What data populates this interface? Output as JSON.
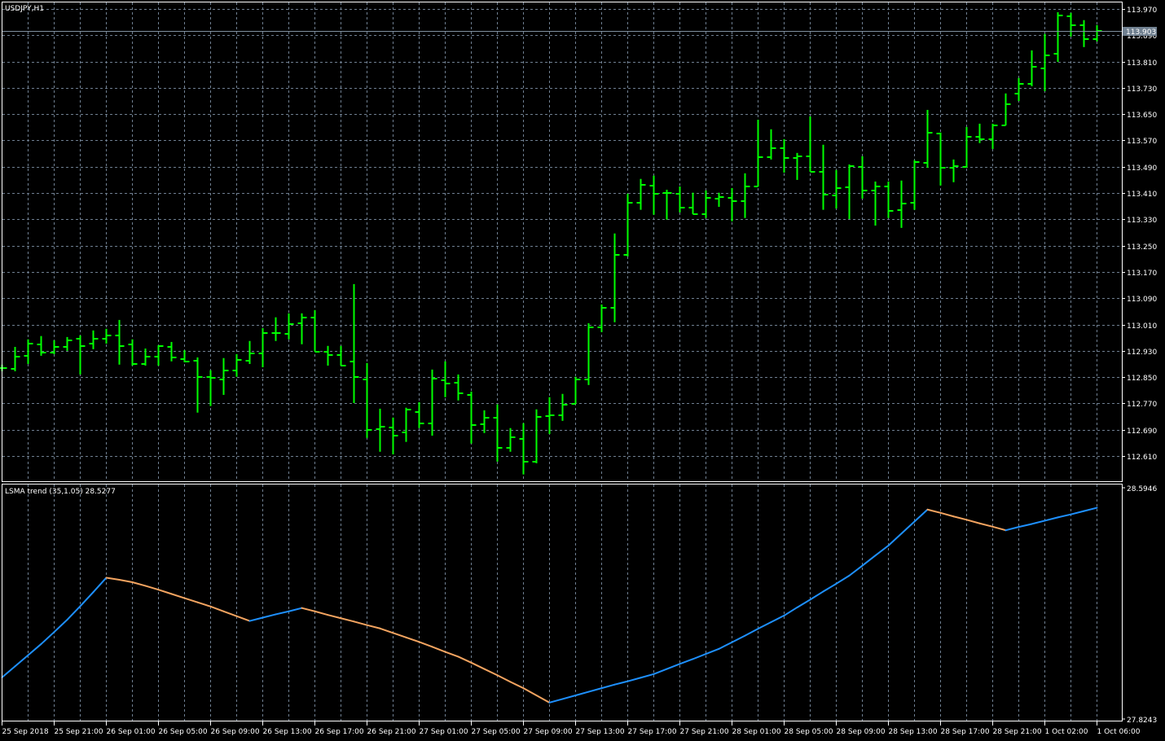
{
  "chart_data": [
    {
      "type": "ohlc-bar",
      "title": "USDJPY,H1",
      "symbol": "USDJPY",
      "timeframe": "H1",
      "ylim": [
        112.57,
        113.99
      ],
      "y_ticks": [
        "113.970",
        "113.890",
        "113.810",
        "113.730",
        "113.650",
        "113.570",
        "113.490",
        "113.410",
        "113.330",
        "113.250",
        "113.170",
        "113.090",
        "113.010",
        "112.930",
        "112.850",
        "112.770",
        "112.690",
        "112.610"
      ],
      "current_price": "113.903",
      "grid": true,
      "bar_color": "#00FF00",
      "bars_ohlc": [
        [
          112.878,
          112.888,
          112.868,
          112.878
        ],
        [
          112.876,
          112.942,
          112.868,
          112.913
        ],
        [
          112.915,
          112.965,
          112.89,
          112.952
        ],
        [
          112.95,
          112.975,
          112.915,
          112.925
        ],
        [
          112.925,
          112.962,
          112.92,
          112.942
        ],
        [
          112.942,
          112.972,
          112.93,
          112.962
        ],
        [
          112.967,
          112.977,
          112.858,
          112.945
        ],
        [
          112.952,
          112.992,
          112.935,
          112.967
        ],
        [
          112.967,
          112.997,
          112.952,
          112.977
        ],
        [
          112.977,
          113.024,
          112.888,
          112.945
        ],
        [
          112.95,
          112.965,
          112.885,
          112.89
        ],
        [
          112.89,
          112.937,
          112.885,
          112.913
        ],
        [
          112.913,
          112.947,
          112.885,
          112.945
        ],
        [
          112.942,
          112.957,
          112.898,
          112.91
        ],
        [
          112.905,
          112.932,
          112.895,
          112.898
        ],
        [
          112.9,
          112.91,
          112.742,
          112.851
        ],
        [
          112.851,
          112.871,
          112.762,
          112.848
        ],
        [
          112.843,
          112.908,
          112.796,
          112.871
        ],
        [
          112.871,
          112.92,
          112.851,
          112.903
        ],
        [
          112.9,
          112.96,
          112.89,
          112.923
        ],
        [
          112.923,
          112.999,
          112.88,
          112.984
        ],
        [
          112.984,
          113.032,
          112.96,
          112.984
        ],
        [
          112.982,
          113.044,
          112.965,
          113.012
        ],
        [
          113.014,
          113.044,
          112.95,
          113.032
        ],
        [
          113.032,
          113.054,
          112.928,
          112.928
        ],
        [
          112.928,
          112.945,
          112.885,
          112.918
        ],
        [
          112.918,
          112.945,
          112.885,
          112.885
        ],
        [
          112.898,
          113.133,
          112.771,
          112.851
        ],
        [
          112.843,
          112.893,
          112.665,
          112.69
        ],
        [
          112.692,
          112.754,
          112.623,
          112.7
        ],
        [
          112.697,
          112.727,
          112.615,
          112.672
        ],
        [
          112.682,
          112.757,
          112.653,
          112.752
        ],
        [
          112.744,
          112.774,
          112.695,
          112.71
        ],
        [
          112.71,
          112.873,
          112.672,
          112.846
        ],
        [
          112.841,
          112.898,
          112.789,
          112.831
        ],
        [
          112.833,
          112.858,
          112.779,
          112.801
        ],
        [
          112.796,
          112.806,
          112.648,
          112.705
        ],
        [
          112.707,
          112.749,
          112.68,
          112.727
        ],
        [
          112.727,
          112.767,
          112.593,
          112.635
        ],
        [
          112.635,
          112.695,
          112.623,
          112.667
        ],
        [
          112.662,
          112.71,
          112.554,
          112.593
        ],
        [
          112.593,
          112.752,
          112.588,
          112.729
        ],
        [
          112.732,
          112.789,
          112.677,
          112.734
        ],
        [
          112.734,
          112.799,
          112.717,
          112.767
        ],
        [
          112.769,
          112.851,
          112.769,
          112.843
        ],
        [
          112.843,
          113.014,
          112.826,
          113.002
        ],
        [
          113.002,
          113.071,
          112.987,
          113.061
        ],
        [
          113.061,
          113.287,
          113.017,
          113.222
        ],
        [
          113.222,
          113.408,
          113.217,
          113.381
        ],
        [
          113.381,
          113.453,
          113.359,
          113.435
        ],
        [
          113.433,
          113.463,
          113.344,
          113.408
        ],
        [
          113.411,
          113.42,
          113.329,
          113.411
        ],
        [
          113.408,
          113.43,
          113.351,
          113.366
        ],
        [
          113.366,
          113.411,
          113.346,
          113.346
        ],
        [
          113.346,
          113.418,
          113.334,
          113.396
        ],
        [
          113.393,
          113.411,
          113.368,
          113.398
        ],
        [
          113.396,
          113.425,
          113.324,
          113.386
        ],
        [
          113.386,
          113.47,
          113.334,
          113.43
        ],
        [
          113.43,
          113.633,
          113.43,
          113.52
        ],
        [
          113.52,
          113.604,
          113.512,
          113.547
        ],
        [
          113.547,
          113.574,
          113.472,
          113.517
        ],
        [
          113.517,
          113.532,
          113.45,
          113.522
        ],
        [
          113.522,
          113.643,
          113.475,
          113.475
        ],
        [
          113.475,
          113.557,
          113.359,
          113.406
        ],
        [
          113.403,
          113.48,
          113.363,
          113.425
        ],
        [
          113.428,
          113.497,
          113.331,
          113.492
        ],
        [
          113.49,
          113.522,
          113.393,
          113.418
        ],
        [
          113.418,
          113.445,
          113.311,
          113.43
        ],
        [
          113.43,
          113.445,
          113.334,
          113.356
        ],
        [
          113.359,
          113.448,
          113.304,
          113.378
        ],
        [
          113.381,
          113.51,
          113.359,
          113.505
        ],
        [
          113.502,
          113.663,
          113.487,
          113.594
        ],
        [
          113.591,
          113.594,
          113.433,
          113.487
        ],
        [
          113.487,
          113.512,
          113.443,
          113.492
        ],
        [
          113.49,
          113.611,
          113.487,
          113.581
        ],
        [
          113.581,
          113.621,
          113.562,
          113.574
        ],
        [
          113.574,
          113.621,
          113.544,
          113.616
        ],
        [
          113.616,
          113.713,
          113.616,
          113.681
        ],
        [
          113.713,
          113.76,
          113.69,
          113.742
        ],
        [
          113.742,
          113.844,
          113.735,
          113.794
        ],
        [
          113.79,
          113.894,
          113.72,
          113.829
        ],
        [
          113.834,
          113.96,
          113.809,
          113.951
        ],
        [
          113.948,
          113.958,
          113.886,
          113.921
        ],
        [
          113.921,
          113.936,
          113.854,
          113.879
        ],
        [
          113.879,
          113.921,
          113.871,
          113.903
        ]
      ],
      "x_tick_labels": [
        "25 Sep 2018",
        "25 Sep 21:00",
        "26 Sep 01:00",
        "26 Sep 05:00",
        "26 Sep 09:00",
        "26 Sep 13:00",
        "26 Sep 17:00",
        "26 Sep 21:00",
        "27 Sep 01:00",
        "27 Sep 05:00",
        "27 Sep 09:00",
        "27 Sep 13:00",
        "27 Sep 17:00",
        "27 Sep 21:00",
        "28 Sep 01:00",
        "28 Sep 05:00",
        "28 Sep 09:00",
        "28 Sep 13:00",
        "28 Sep 17:00",
        "28 Sep 21:00",
        "1 Oct 02:00",
        "1 Oct 06:00"
      ],
      "x_tick_every_bars": 4
    },
    {
      "type": "line",
      "title": "LSMA trend (35,1.05) 28.5277",
      "ylim": [
        27.8243,
        28.5946
      ],
      "y_ticks": [
        "28.5946",
        "27.8243"
      ],
      "up_color": "#1E90FF",
      "down_color": "#F4A460",
      "values": [
        27.963,
        28.0,
        28.037,
        28.074,
        28.114,
        28.155,
        28.2,
        28.247,
        28.295,
        28.288,
        28.28,
        28.268,
        28.255,
        28.241,
        28.227,
        28.213,
        28.199,
        28.183,
        28.167,
        28.151,
        28.162,
        28.173,
        28.183,
        28.194,
        28.183,
        28.171,
        28.16,
        28.149,
        28.137,
        28.126,
        28.111,
        28.096,
        28.081,
        28.065,
        28.048,
        28.032,
        28.012,
        27.991,
        27.97,
        27.948,
        27.927,
        27.903,
        27.879,
        27.891,
        27.903,
        27.915,
        27.927,
        27.939,
        27.95,
        27.962,
        27.974,
        27.991,
        28.008,
        28.024,
        28.041,
        28.058,
        28.08,
        28.102,
        28.125,
        28.147,
        28.169,
        28.196,
        28.222,
        28.249,
        28.275,
        28.302,
        28.335,
        28.369,
        28.402,
        28.442,
        28.482,
        28.522,
        28.511,
        28.499,
        28.488,
        28.476,
        28.465,
        28.453,
        28.464,
        28.474,
        28.485,
        28.496,
        28.506,
        28.517,
        28.528
      ]
    }
  ]
}
